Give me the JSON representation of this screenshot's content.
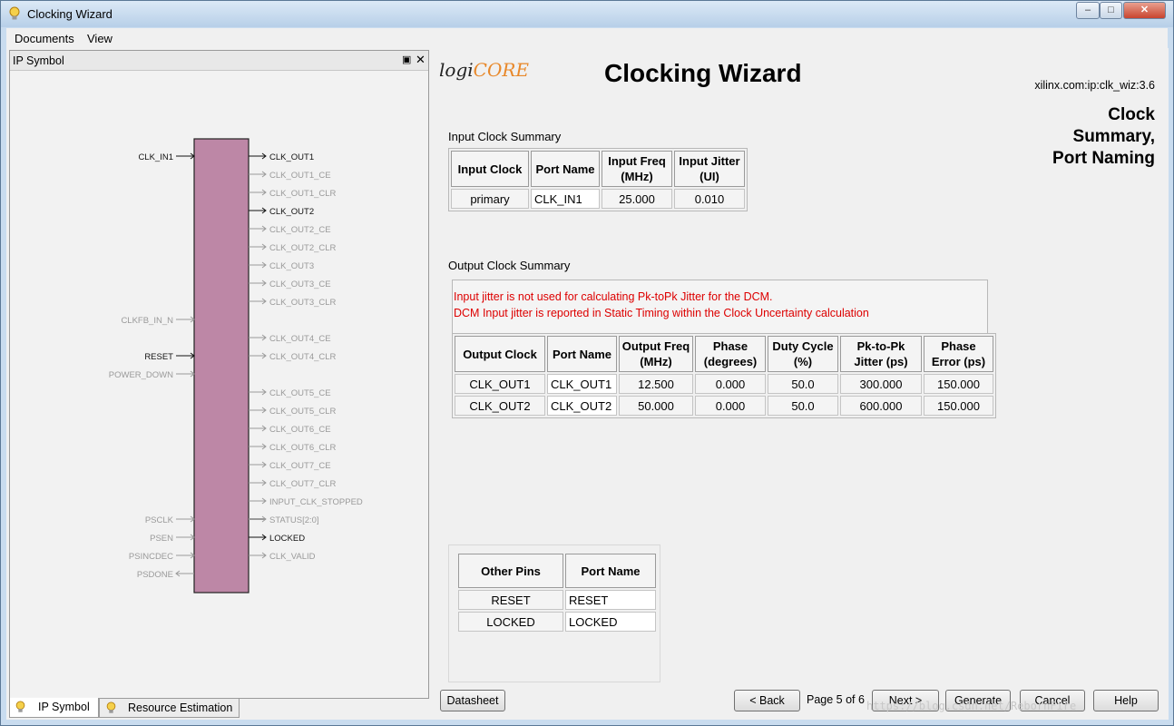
{
  "window": {
    "title": "Clocking Wizard",
    "menu": [
      "Documents",
      "View"
    ]
  },
  "left_panel": {
    "header": "IP Symbol",
    "left_pins": [
      {
        "name": "CLK_IN1",
        "active": true
      },
      {
        "name": "CLKFB_IN_N",
        "active": false
      },
      {
        "name": "RESET",
        "active": true
      },
      {
        "name": "POWER_DOWN",
        "active": false
      },
      {
        "name": "PSCLK",
        "active": false
      },
      {
        "name": "PSEN",
        "active": false
      },
      {
        "name": "PSINCDEC",
        "active": false
      },
      {
        "name": "PSDONE",
        "active": false
      }
    ],
    "right_pins": [
      {
        "name": "CLK_OUT1",
        "active": true
      },
      {
        "name": "CLK_OUT1_CE",
        "active": false
      },
      {
        "name": "CLK_OUT1_CLR",
        "active": false
      },
      {
        "name": "CLK_OUT2",
        "active": true
      },
      {
        "name": "CLK_OUT2_CE",
        "active": false
      },
      {
        "name": "CLK_OUT2_CLR",
        "active": false
      },
      {
        "name": "CLK_OUT3",
        "active": false
      },
      {
        "name": "CLK_OUT3_CE",
        "active": false
      },
      {
        "name": "CLK_OUT3_CLR",
        "active": false
      },
      {
        "name": "CLK_OUT4_CE",
        "active": false
      },
      {
        "name": "CLK_OUT4_CLR",
        "active": false
      },
      {
        "name": "CLK_OUT5_CE",
        "active": false
      },
      {
        "name": "CLK_OUT5_CLR",
        "active": false
      },
      {
        "name": "CLK_OUT6_CE",
        "active": false
      },
      {
        "name": "CLK_OUT6_CLR",
        "active": false
      },
      {
        "name": "CLK_OUT7_CE",
        "active": false
      },
      {
        "name": "CLK_OUT7_CLR",
        "active": false
      },
      {
        "name": "INPUT_CLK_STOPPED",
        "active": false
      },
      {
        "name": "STATUS[2:0]",
        "active": false
      },
      {
        "name": "LOCKED",
        "active": true
      },
      {
        "name": "CLK_VALID",
        "active": false
      }
    ],
    "symbol_color": "#bd87a6",
    "tabs": [
      "IP Symbol",
      "Resource Estimation"
    ]
  },
  "header": {
    "logo_prefix": "logi",
    "logo_suffix": "CORE",
    "title": "Clocking Wizard",
    "ip_id": "xilinx.com:ip:clk_wiz:3.6",
    "section": "Clock Summary, Port Naming"
  },
  "input_summary": {
    "label": "Input Clock Summary",
    "headers": [
      "Input Clock",
      "Port Name",
      "Input Freq (MHz)",
      "Input Jitter (UI)"
    ],
    "rows": [
      [
        "primary",
        "CLK_IN1",
        "25.000",
        "0.010"
      ]
    ]
  },
  "output_summary": {
    "label": "Output Clock Summary",
    "notes": [
      "Input jitter is not used for calculating Pk-toPk Jitter for the DCM.",
      "DCM Input jitter is reported in Static Timing within the Clock Uncertainty calculation"
    ],
    "headers": [
      "Output Clock",
      "Port Name",
      "Output Freq (MHz)",
      "Phase (degrees)",
      "Duty Cycle (%)",
      "Pk-to-Pk Jitter (ps)",
      "Phase Error (ps)"
    ],
    "rows": [
      [
        "CLK_OUT1",
        "CLK_OUT1",
        "12.500",
        "0.000",
        "50.0",
        "300.000",
        "150.000"
      ],
      [
        "CLK_OUT2",
        "CLK_OUT2",
        "50.000",
        "0.000",
        "50.0",
        "600.000",
        "150.000"
      ]
    ]
  },
  "other_pins": {
    "headers": [
      "Other Pins",
      "Port Name"
    ],
    "rows": [
      [
        "RESET",
        "RESET"
      ],
      [
        "LOCKED",
        "LOCKED"
      ]
    ]
  },
  "footer": {
    "datasheet": "Datasheet",
    "back": "< Back",
    "page": "Page 5 of 6",
    "next": "Next >",
    "generate": "Generate",
    "cancel": "Cancel",
    "help": "Help"
  },
  "watermark": "https://blog.csdn.net/RebornFire"
}
